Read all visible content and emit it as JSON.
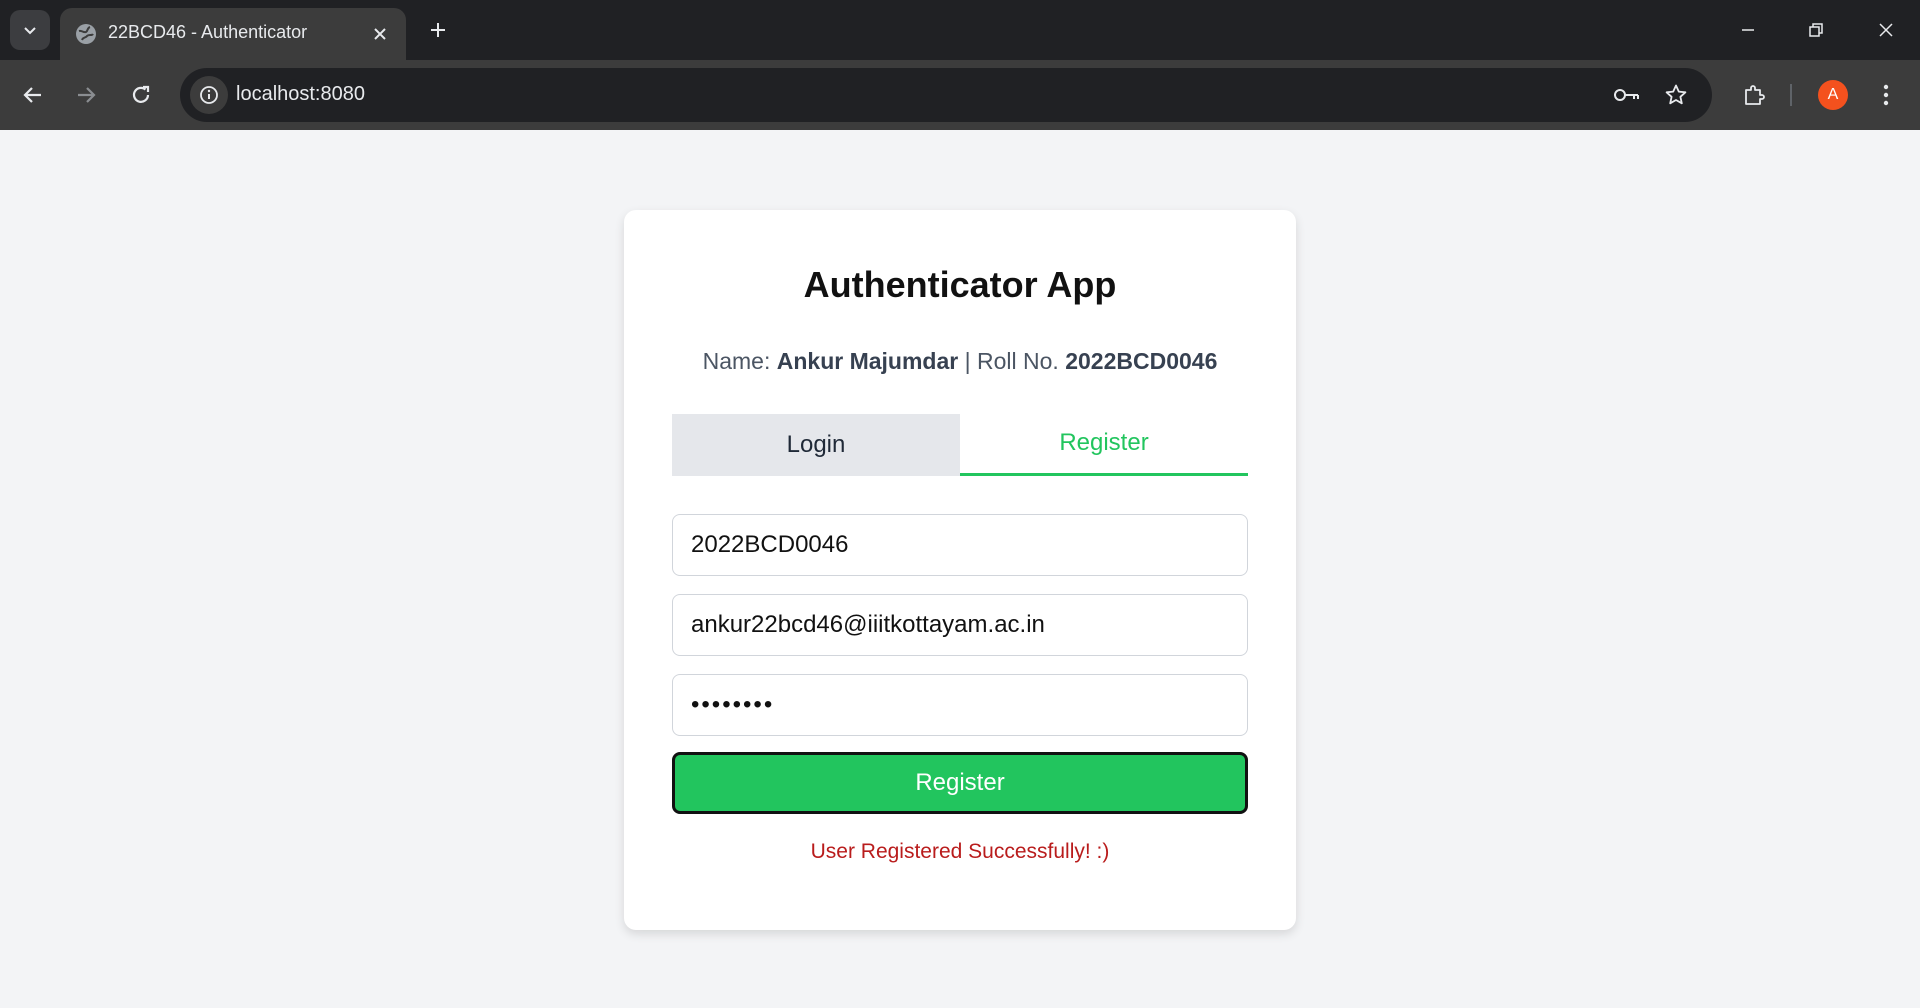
{
  "browser": {
    "tab_title": "22BCD46 - Authenticator",
    "url": "localhost:8080",
    "profile_initial": "A"
  },
  "app": {
    "title": "Authenticator App",
    "student": {
      "name_label": "Name:",
      "name": "Ankur Majumdar",
      "separator": "|",
      "roll_label": "Roll No.",
      "roll": "2022BCD0046"
    },
    "tabs": [
      {
        "label": "Login",
        "active": false
      },
      {
        "label": "Register",
        "active": true
      }
    ],
    "form": {
      "username": "2022BCD0046",
      "email": "ankur22bcd46@iiitkottayam.ac.in",
      "password": "••••••••",
      "submit_label": "Register"
    },
    "status_message": "User Registered Successfully! :)"
  },
  "colors": {
    "accent": "#22c55e",
    "error": "#b91c1c",
    "page_bg": "#f3f4f6"
  }
}
